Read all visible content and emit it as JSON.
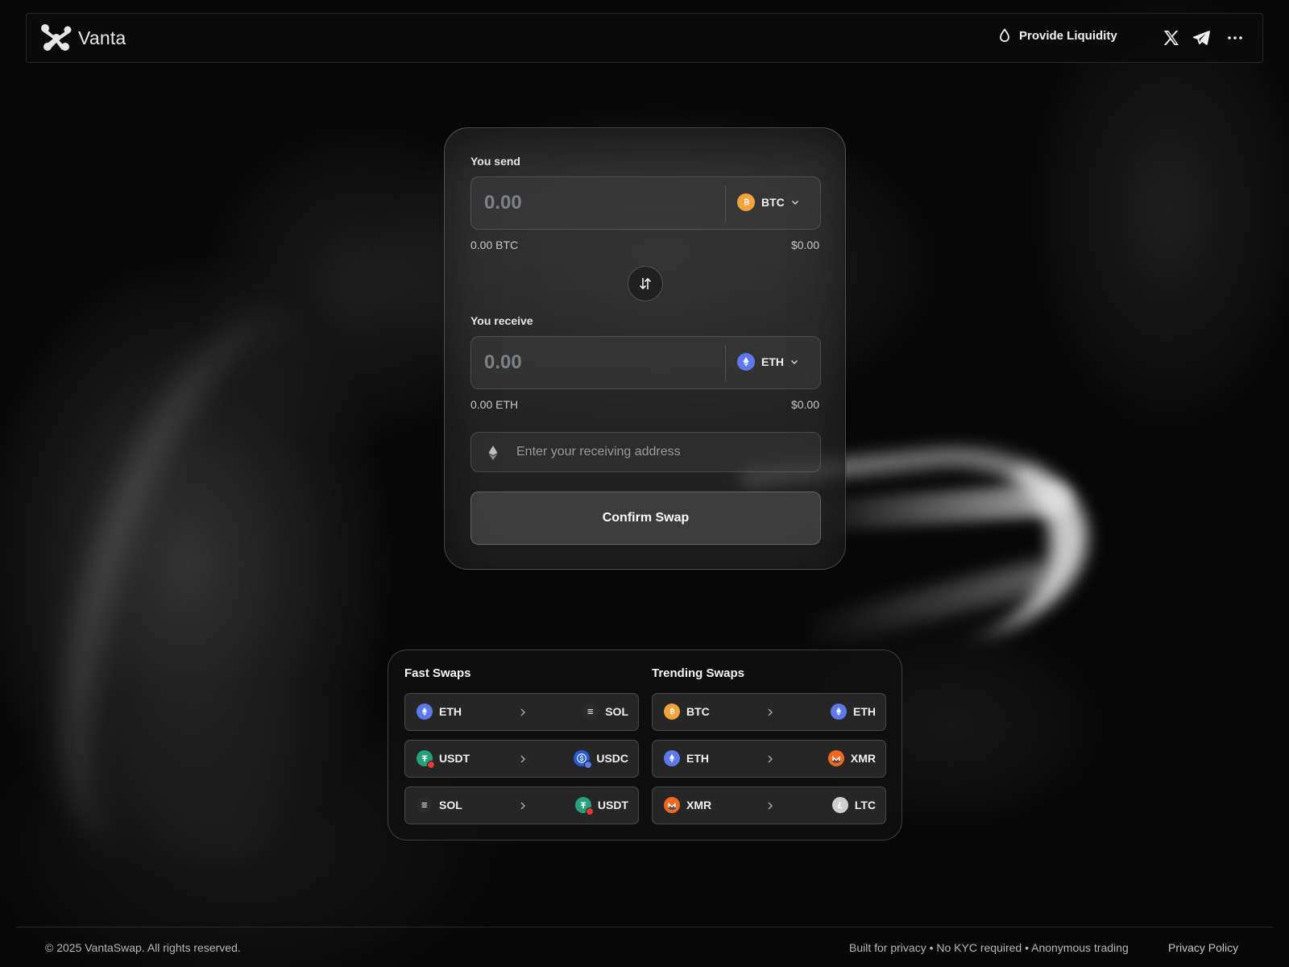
{
  "header": {
    "logo_text": "Vanta",
    "provide_liquidity": "Provide Liquidity"
  },
  "swap": {
    "send_label": "You send",
    "send_placeholder": "0.00",
    "send_token": "BTC",
    "send_balance": "0.00 BTC",
    "send_usd": "$0.00",
    "receive_label": "You receive",
    "receive_placeholder": "0.00",
    "receive_token": "ETH",
    "receive_balance": "0.00 ETH",
    "receive_usd": "$0.00",
    "address_placeholder": "Enter your receiving address",
    "confirm_label": "Confirm Swap"
  },
  "fast_swaps": {
    "title": "Fast Swaps",
    "pairs": [
      {
        "from": "ETH",
        "to": "SOL"
      },
      {
        "from": "USDT",
        "to": "USDC"
      },
      {
        "from": "SOL",
        "to": "USDT"
      }
    ]
  },
  "trending_swaps": {
    "title": "Trending Swaps",
    "pairs": [
      {
        "from": "BTC",
        "to": "ETH"
      },
      {
        "from": "ETH",
        "to": "XMR"
      },
      {
        "from": "XMR",
        "to": "LTC"
      }
    ]
  },
  "colors": {
    "btc": "#f2a33c",
    "eth": "#6079ea",
    "usdt": "#26a17b",
    "usdc": "#2a5bd7",
    "xmr": "#f26822",
    "ltc": "#cfcfcf"
  },
  "icons": [
    "droplet-icon",
    "x-logo-icon",
    "telegram-icon",
    "more-icon",
    "swap-direction-icon",
    "ethereum-icon",
    "chevron-down-icon",
    "chevron-right-icon"
  ],
  "footer": {
    "copyright": "© 2025 VantaSwap. All rights reserved.",
    "tagline": "Built for privacy • No KYC required • Anonymous trading",
    "privacy_link": "Privacy Policy"
  }
}
